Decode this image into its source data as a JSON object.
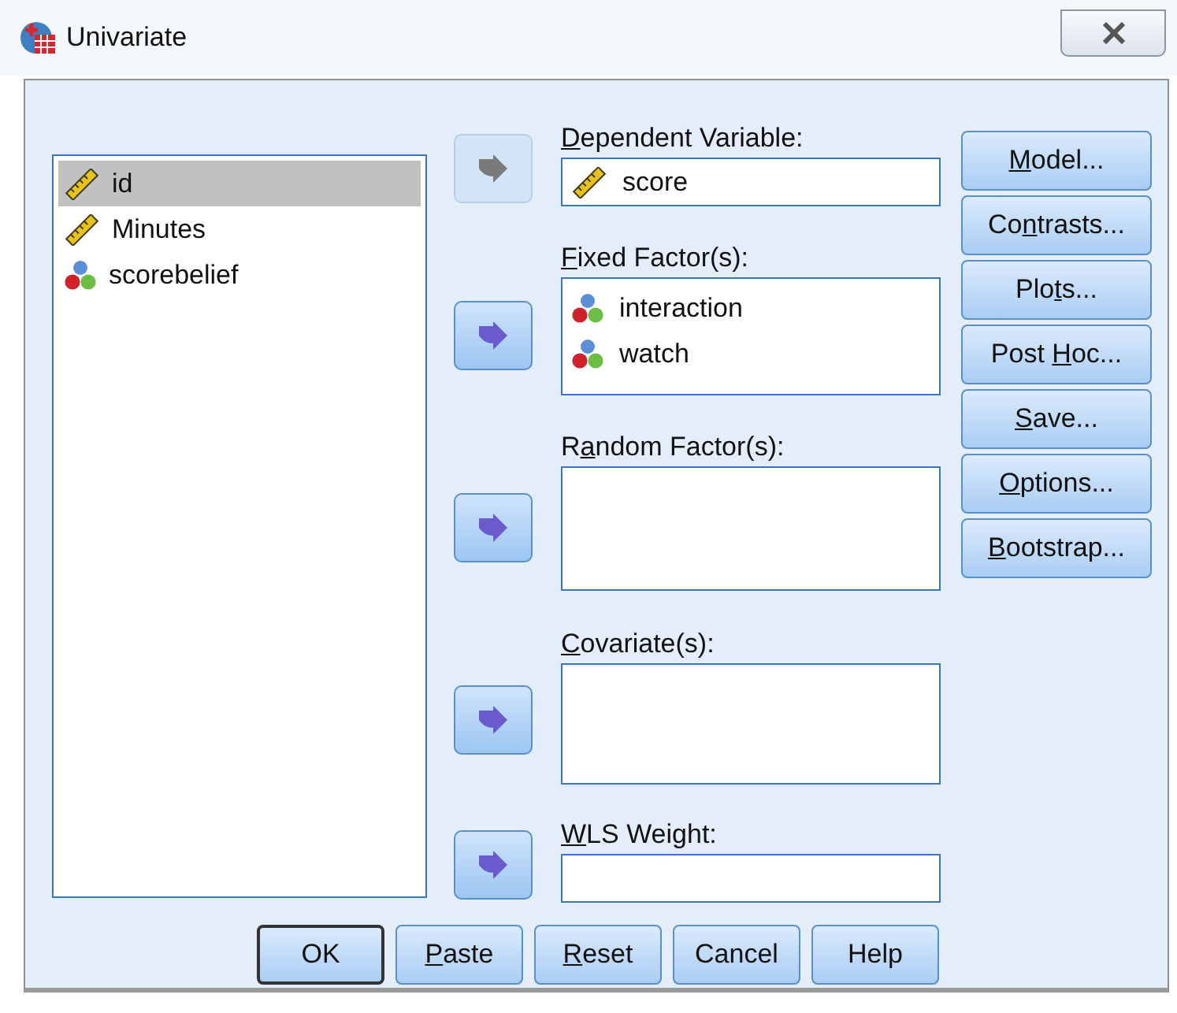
{
  "window": {
    "title": "Univariate"
  },
  "variables": [
    {
      "name": "id",
      "kind": "scale",
      "selected": true
    },
    {
      "name": "Minutes",
      "kind": "scale",
      "selected": false
    },
    {
      "name": "scorebelief",
      "kind": "nominal",
      "selected": false
    }
  ],
  "targets": [
    {
      "label": {
        "key": "D",
        "post": "ependent Variable:"
      },
      "arrow_disabled": true,
      "kind": "single",
      "items": [
        {
          "name": "score",
          "kind": "scale"
        }
      ]
    },
    {
      "label": {
        "key": "F",
        "post": "ixed Factor(s):"
      },
      "arrow_disabled": false,
      "kind": "list",
      "items": [
        {
          "name": "interaction",
          "kind": "nominal"
        },
        {
          "name": "watch",
          "kind": "nominal"
        }
      ]
    },
    {
      "label": {
        "pre": "R",
        "key": "a",
        "post": "ndom Factor(s):"
      },
      "arrow_disabled": false,
      "kind": "list"
    },
    {
      "label": {
        "key": "C",
        "post": "ovariate(s):"
      },
      "arrow_disabled": false,
      "kind": "list"
    },
    {
      "label": {
        "key": "W",
        "post": "LS Weight:"
      },
      "arrow_disabled": false,
      "kind": "single"
    }
  ],
  "side_buttons": [
    {
      "key": "M",
      "post": "odel..."
    },
    {
      "pre": "Co",
      "key": "n",
      "post": "trasts..."
    },
    {
      "pre": "Plo",
      "key": "t",
      "post": "s..."
    },
    {
      "pre": "Post ",
      "key": "H",
      "post": "oc..."
    },
    {
      "key": "S",
      "post": "ave..."
    },
    {
      "key": "O",
      "post": "ptions..."
    },
    {
      "key": "B",
      "post": "ootstrap..."
    }
  ],
  "bottom_buttons": [
    {
      "label": {
        "pre": "OK"
      },
      "default": true
    },
    {
      "label": {
        "key": "P",
        "post": "aste"
      },
      "default": false
    },
    {
      "label": {
        "key": "R",
        "post": "eset"
      },
      "default": false
    },
    {
      "label": {
        "pre": "Cancel"
      },
      "default": false
    },
    {
      "label": {
        "pre": "Help"
      },
      "default": false
    }
  ]
}
